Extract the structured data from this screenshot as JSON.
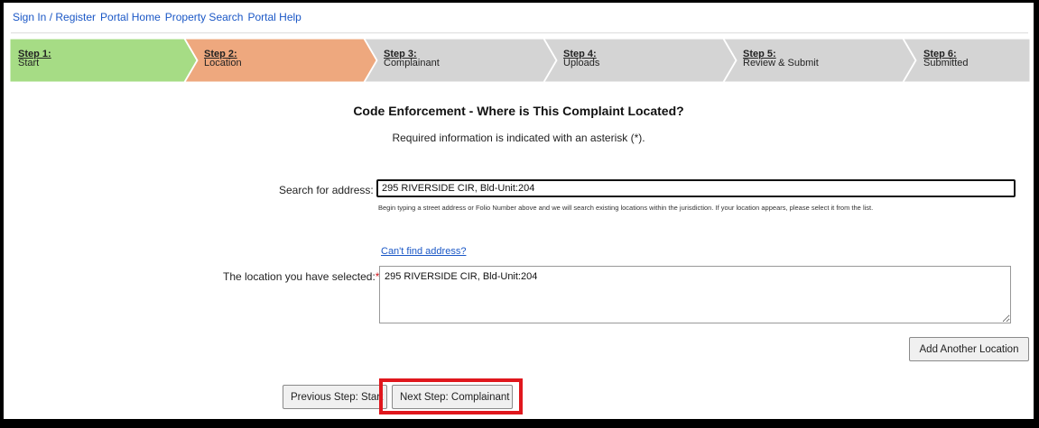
{
  "nav": {
    "links": [
      "Sign In / Register",
      "Portal Home",
      "Property Search",
      "Portal Help"
    ]
  },
  "steps": [
    {
      "num": "Step 1:",
      "name": "Start",
      "state": "completed",
      "color": "#a6dc85"
    },
    {
      "num": "Step 2:",
      "name": "Location",
      "state": "current",
      "color": "#eea87e"
    },
    {
      "num": "Step 3:",
      "name": "Complainant",
      "state": "pending",
      "color": "#d4d4d4"
    },
    {
      "num": "Step 4:",
      "name": "Uploads",
      "state": "pending",
      "color": "#d4d4d4"
    },
    {
      "num": "Step 5:",
      "name": "Review & Submit",
      "state": "pending",
      "color": "#d4d4d4"
    },
    {
      "num": "Step 6:",
      "name": "Submitted",
      "state": "pending",
      "color": "#d4d4d4"
    }
  ],
  "page": {
    "heading": "Code Enforcement - Where is This Complaint Located?",
    "required_note": "Required information is indicated with an asterisk (*)."
  },
  "search": {
    "label": "Search for address:",
    "value": "295 RIVERSIDE CIR, Bld-Unit:204",
    "hint": "Begin typing a street address or Folio Number above and we will search existing locations within the jurisdiction. If your location appears, please select it from the list."
  },
  "cant_find": "Can't find address?",
  "selected_location": {
    "label": "The location you have selected:",
    "required_marker": "*",
    "value": "295 RIVERSIDE CIR, Bld-Unit:204"
  },
  "buttons": {
    "add_location": "Add Another Location",
    "previous": "Previous Step: Start",
    "next": "Next Step: Complainant"
  },
  "colors": {
    "link": "#1a57c6",
    "highlight": "#e0171d",
    "required": "#d0141b"
  }
}
